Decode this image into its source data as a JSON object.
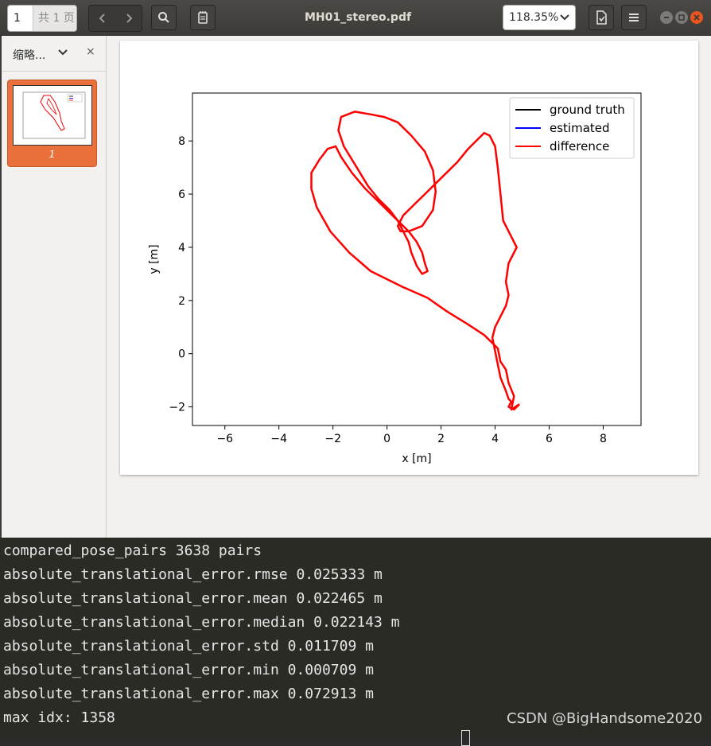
{
  "toolbar": {
    "page_number": "1",
    "page_total": "共 1 页",
    "title": "MH01_stereo.pdf",
    "zoom": "118.35%",
    "icons": [
      "chevron-left-icon",
      "chevron-right-icon",
      "search-icon",
      "annotations-icon",
      "save-document-icon",
      "menu-icon",
      "minimize-icon",
      "maximize-icon",
      "close-icon"
    ]
  },
  "sidebar": {
    "title": "缩略...",
    "close": "×",
    "thumbnail_label": "1"
  },
  "chart_data": {
    "type": "line",
    "title": "",
    "xlabel": "x [m]",
    "ylabel": "y [m]",
    "xlim": [
      -7.2,
      9.4
    ],
    "ylim": [
      -2.7,
      9.8
    ],
    "xticks": [
      "−6",
      "−4",
      "−2",
      "0",
      "2",
      "4",
      "6",
      "8"
    ],
    "yticks": [
      "−2",
      "0",
      "2",
      "4",
      "6",
      "8"
    ],
    "grid": false,
    "legend_position": "top-right",
    "series": [
      {
        "name": "ground truth",
        "color": "#000000"
      },
      {
        "name": "estimated",
        "color": "#0000ff"
      },
      {
        "name": "difference",
        "color": "#ff0000",
        "x": [
          4.9,
          4.6,
          4.7,
          4.5,
          4.4,
          4.2,
          4.1,
          3.9,
          3.6,
          3.0,
          2.2,
          1.5,
          0.6,
          -0.6,
          -1.4,
          -2.1,
          -2.6,
          -2.8,
          -2.8,
          -2.5,
          -2.2,
          -1.9,
          -1.7,
          -1.3,
          -0.8,
          -0.2,
          0.4,
          0.8,
          1.1,
          1.3,
          1.4,
          1.5,
          1.3,
          1.1,
          0.9,
          0.8,
          0.6,
          0.4,
          0.1,
          -0.3,
          -0.7,
          -1.0,
          -1.3,
          -1.6,
          -1.8,
          -1.7,
          -1.2,
          -0.6,
          -0.1,
          0.4,
          0.9,
          1.4,
          1.7,
          1.8,
          1.7,
          1.3,
          0.8,
          0.5,
          0.4,
          0.6,
          1.0,
          1.4,
          1.8,
          2.2,
          2.6,
          3.0,
          3.4,
          3.6,
          3.8,
          4.0,
          4.1,
          4.2,
          4.3,
          4.6,
          4.8,
          4.5,
          4.4,
          4.5,
          4.4,
          4.2,
          4.0,
          3.9,
          4.0,
          4.1,
          4.2,
          4.4,
          4.5,
          4.6,
          4.5,
          4.7,
          4.9
        ],
        "y": [
          -1.9,
          -2.1,
          -1.6,
          -1.1,
          -0.6,
          -0.3,
          0.2,
          0.4,
          0.7,
          1.1,
          1.6,
          2.1,
          2.5,
          3.1,
          3.8,
          4.6,
          5.5,
          6.2,
          6.8,
          7.3,
          7.7,
          7.8,
          7.4,
          6.8,
          6.2,
          5.6,
          5.0,
          4.6,
          4.2,
          3.8,
          3.4,
          3.1,
          3.0,
          3.3,
          3.8,
          4.2,
          4.6,
          5.0,
          5.4,
          5.8,
          6.3,
          6.8,
          7.3,
          7.8,
          8.4,
          8.9,
          9.1,
          9.0,
          8.9,
          8.7,
          8.2,
          7.6,
          6.9,
          6.1,
          5.4,
          4.8,
          4.6,
          4.6,
          4.8,
          5.2,
          5.6,
          6.0,
          6.4,
          6.8,
          7.2,
          7.7,
          8.1,
          8.3,
          8.2,
          7.8,
          7.0,
          6.0,
          5.0,
          4.4,
          4.0,
          3.4,
          2.7,
          2.2,
          1.8,
          1.4,
          1.0,
          0.6,
          0.1,
          -0.4,
          -0.9,
          -1.4,
          -1.7,
          -1.8,
          -2.0,
          -2.1,
          -1.9
        ]
      }
    ]
  },
  "terminal": {
    "lines": [
      "compared_pose_pairs 3638 pairs",
      "absolute_translational_error.rmse 0.025333 m",
      "absolute_translational_error.mean 0.022465 m",
      "absolute_translational_error.median 0.022143 m",
      "absolute_translational_error.std 0.011709 m",
      "absolute_translational_error.min 0.000709 m",
      "absolute_translational_error.max 0.072913 m",
      "max idx: 1358"
    ]
  },
  "watermark": "CSDN @BigHandsome2020"
}
